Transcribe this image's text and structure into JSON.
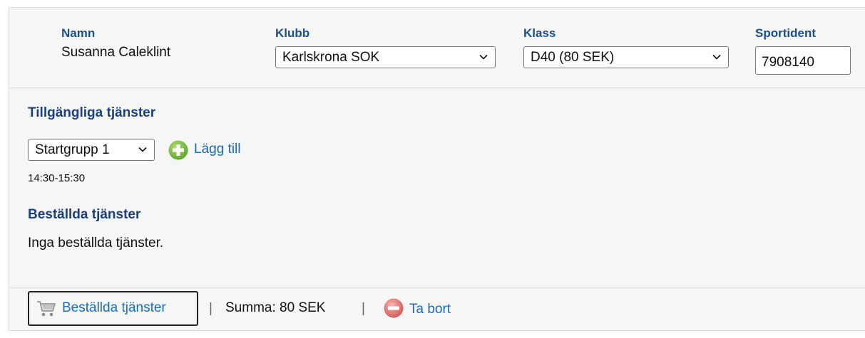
{
  "participant": {
    "name_label": "Namn",
    "name_value": "Susanna Caleklint",
    "club_label": "Klubb",
    "club_value": "Karlskrona SOK",
    "class_label": "Klass",
    "class_value": "D40 (80 SEK)",
    "sportident_label": "Sportident",
    "sportident_value": "7908140"
  },
  "available": {
    "title": "Tillgängliga tjänster",
    "select_value": "Startgrupp 1",
    "add_label": "Lägg till",
    "time_text": "14:30-15:30"
  },
  "ordered": {
    "title": "Beställda tjänster",
    "empty_text": "Inga beställda tjänster."
  },
  "footer": {
    "cart_label": "Beställda tjänster",
    "separator": "|",
    "sum_text": "Summa: 80 SEK",
    "remove_label": "Ta bort"
  },
  "icons": {
    "add": "plus-circle-icon",
    "remove": "minus-circle-icon",
    "cart": "shopping-cart-icon",
    "chevron": "chevron-down-icon"
  },
  "colors": {
    "label": "#1a4f8e",
    "link": "#1a6bbf",
    "add_icon": "#7cc242",
    "remove_icon": "#e06b6b"
  }
}
